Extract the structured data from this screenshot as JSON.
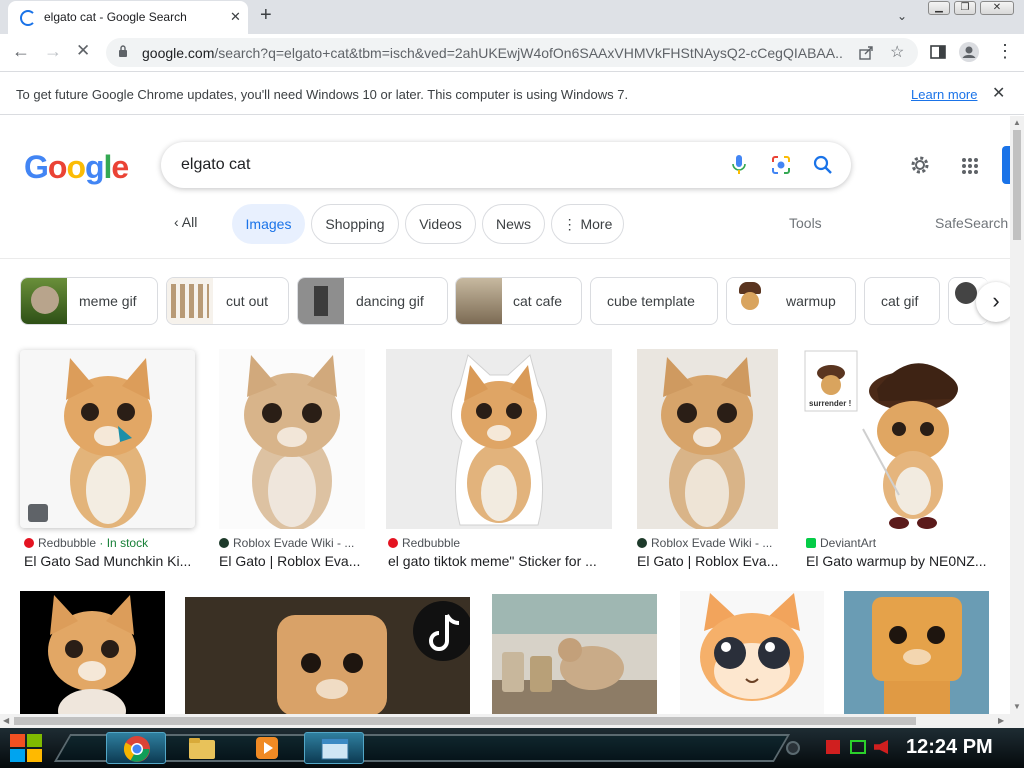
{
  "browser": {
    "tab_title": "elgato cat - Google Search",
    "tab_close": "✕",
    "new_tab": "+",
    "url_host": "google.com",
    "url_rest": "/search?q=elgato+cat&tbm=isch&ved=2ahUKEwjW4ofOn6SAAxVHMVkFHStNAysQ2-cCegQIABAA...",
    "window_controls": [
      "minimize",
      "restore",
      "close"
    ]
  },
  "infobar": {
    "message": "To get future Google Chrome updates, you'll need Windows 10 or later. This computer is using Windows 7.",
    "link": "Learn more",
    "close": "✕"
  },
  "search": {
    "logo": "Google",
    "query": "elgato cat"
  },
  "filters": {
    "all": "All",
    "images": "Images",
    "shopping": "Shopping",
    "videos": "Videos",
    "news": "News",
    "more": "More",
    "tools": "Tools",
    "safesearch": "SafeSearch"
  },
  "related": [
    "meme gif",
    "cut out",
    "dancing gif",
    "cat cafe",
    "cube template",
    "warmup",
    "cat gif"
  ],
  "results": [
    {
      "source": "Redbubble",
      "extra": " · In stock",
      "title": "El Gato Sad Munchkin Ki..."
    },
    {
      "source": "Roblox Evade Wiki - ...",
      "extra": "",
      "title": "El Gato | Roblox Eva..."
    },
    {
      "source": "Redbubble",
      "extra": "",
      "title": "el gato tiktok meme\" Sticker for ..."
    },
    {
      "source": "Roblox Evade Wiki - ...",
      "extra": "",
      "title": "El Gato | Roblox Eva..."
    },
    {
      "source": "DeviantArt",
      "extra": "",
      "title": "El Gato warmup by NE0NZ..."
    }
  ],
  "image_overlay_text": "surrender !",
  "taskbar": {
    "clock": "12:24 PM"
  },
  "colors": {
    "accent": "#1a73e8",
    "link": "#1a73e8",
    "stock_green": "#188038"
  }
}
